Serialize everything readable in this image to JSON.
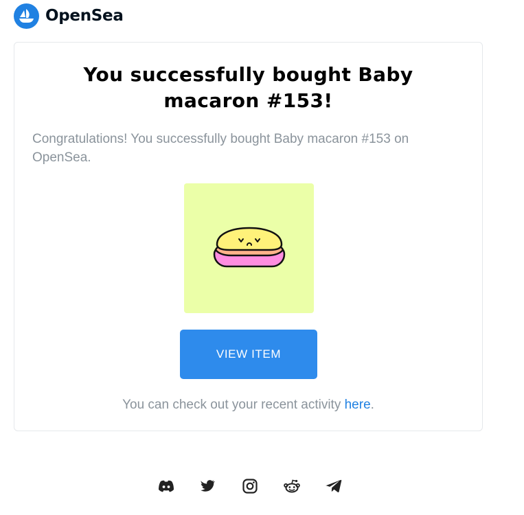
{
  "header": {
    "brand": "OpenSea",
    "logo_icon": "opensea-ship-icon",
    "logo_color": "#2081e2"
  },
  "card": {
    "title": "You successfully bought Baby macaron #153!",
    "description": "Congratulations! You successfully bought Baby macaron #153 on OpenSea.",
    "image_icon": "macaron-nft-image",
    "image_bg": "#ebffa8",
    "button_label": "VIEW ITEM",
    "button_color": "#2e8bec",
    "footer_prefix": "You can check out your recent activity ",
    "footer_link": "here",
    "footer_suffix": "."
  },
  "socials": [
    {
      "name": "discord-icon"
    },
    {
      "name": "twitter-icon"
    },
    {
      "name": "instagram-icon"
    },
    {
      "name": "reddit-icon"
    },
    {
      "name": "telegram-icon"
    }
  ]
}
